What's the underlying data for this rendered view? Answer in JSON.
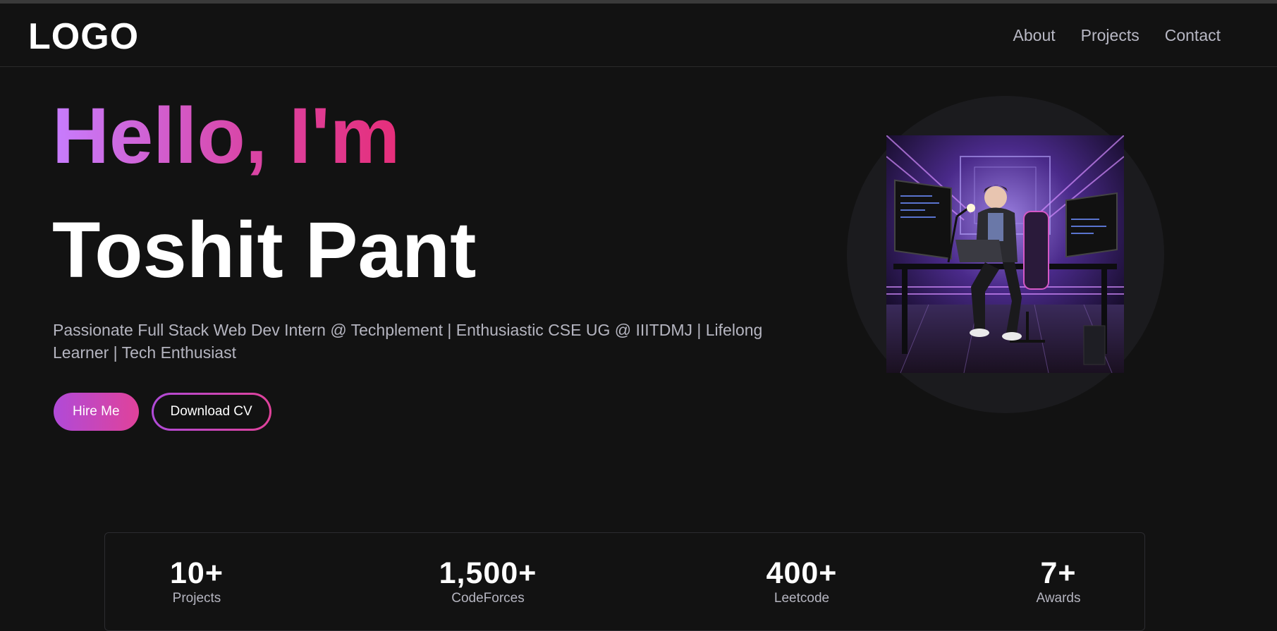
{
  "navbar": {
    "logo": "LOGO",
    "links": [
      "About",
      "Projects",
      "Contact"
    ]
  },
  "hero": {
    "greeting": "Hello, I'm",
    "name": "Toshit Pant",
    "tagline": "Passionate Full Stack Web Dev Intern @ Techplement | Enthusiastic CSE UG @ IIITDMJ | Lifelong Learner | Tech Enthusiast",
    "hire_button": "Hire Me",
    "cv_button": "Download CV",
    "avatar_icon": "developer-at-desk-illustration"
  },
  "stats": [
    {
      "value": "10+",
      "label": "Projects"
    },
    {
      "value": "1,500+",
      "label": "CodeForces"
    },
    {
      "value": "400+",
      "label": "Leetcode"
    },
    {
      "value": "7+",
      "label": "Awards"
    }
  ],
  "colors": {
    "background": "#121212",
    "gradient_start": "#c77dff",
    "gradient_end": "#e62e7a",
    "muted_text": "#b5b5c0"
  }
}
